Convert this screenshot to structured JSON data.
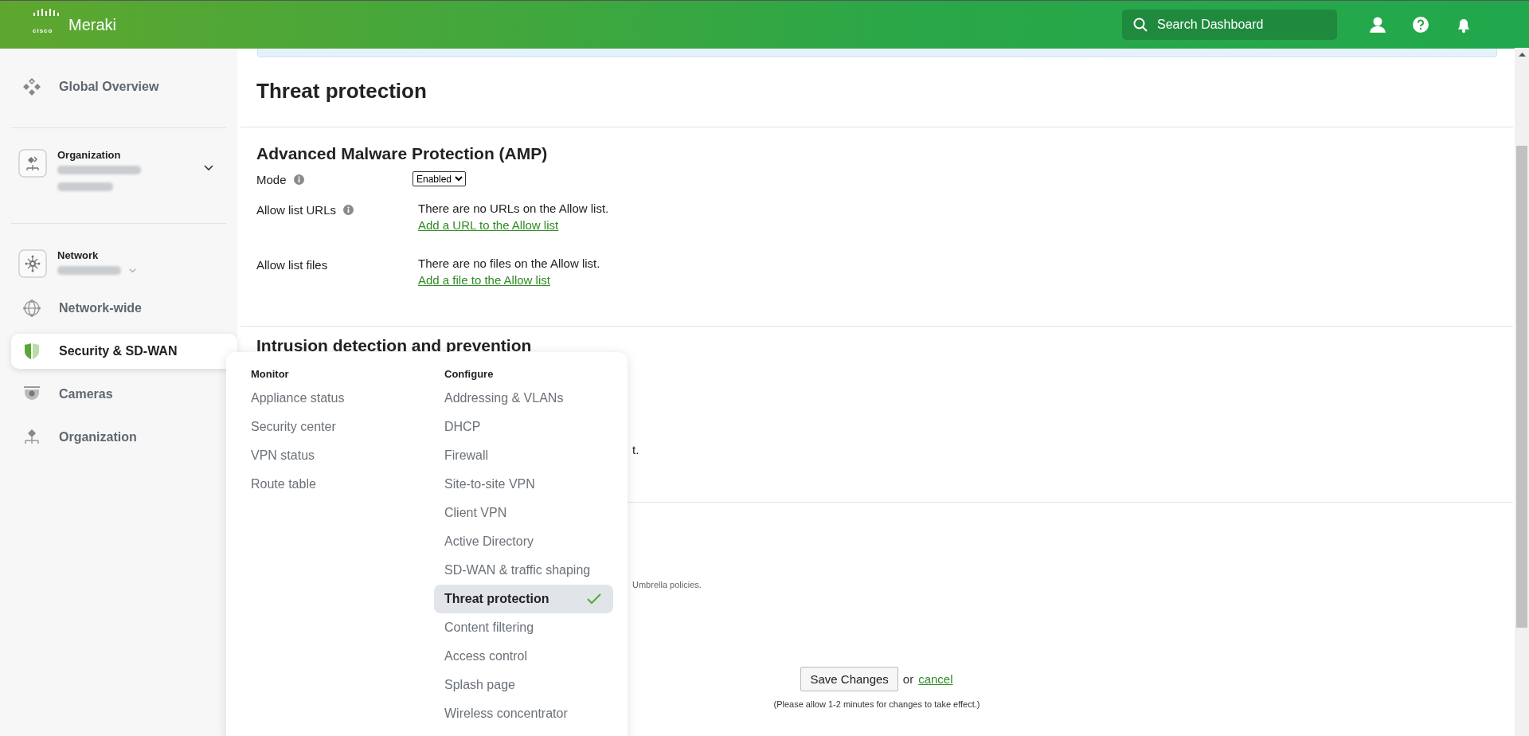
{
  "header": {
    "logo_mark": "cisco",
    "logo_text": "Meraki",
    "search": {
      "placeholder": "Search Dashboard"
    }
  },
  "sidebar": {
    "sections": [
      [
        {
          "kind": "link",
          "label": "Global Overview",
          "selected": false
        }
      ],
      [
        {
          "kind": "picker",
          "label": "Organization",
          "selected": false
        }
      ],
      [
        {
          "kind": "picker",
          "label": "Network",
          "selected": false
        },
        {
          "kind": "link",
          "label": "Network-wide",
          "selected": false
        },
        {
          "kind": "link",
          "label": "Security & SD-WAN",
          "selected": true
        },
        {
          "kind": "link",
          "label": "Cameras",
          "selected": false
        },
        {
          "kind": "link",
          "label": "Organization",
          "selected": false
        }
      ]
    ]
  },
  "page_title": "Threat protection",
  "amp": {
    "heading": "Advanced Malware Protection (AMP)",
    "fields": [
      {
        "kind": "select",
        "label": "Mode",
        "info": true,
        "value": "Enabled"
      },
      {
        "kind": "list",
        "label": "Allow list URLs",
        "info": true,
        "text": "There are no URLs on the Allow list.",
        "link": "Add a URL to the Allow list"
      },
      {
        "kind": "list",
        "label": "Allow list files",
        "info": false,
        "text": "There are no files on the Allow list.",
        "link": "Add a file to the Allow list"
      }
    ]
  },
  "ids": {
    "heading": "Intrusion detection and prevention",
    "fragment": "t."
  },
  "umbrella": {
    "fragment": "Umbrella policies."
  },
  "footer": {
    "save": "Save Changes",
    "or": "or",
    "cancel": "cancel",
    "note": "(Please allow 1-2 minutes for changes to take effect.)"
  },
  "flyout": {
    "columns": [
      {
        "heading": "Monitor",
        "items": [
          {
            "label": "Appliance status",
            "selected": false
          },
          {
            "label": "Security center",
            "selected": false
          },
          {
            "label": "VPN status",
            "selected": false
          },
          {
            "label": "Route table",
            "selected": false
          }
        ]
      },
      {
        "heading": "Configure",
        "items": [
          {
            "label": "Addressing & VLANs",
            "selected": false
          },
          {
            "label": "DHCP",
            "selected": false
          },
          {
            "label": "Firewall",
            "selected": false
          },
          {
            "label": "Site-to-site VPN",
            "selected": false
          },
          {
            "label": "Client VPN",
            "selected": false
          },
          {
            "label": "Active Directory",
            "selected": false
          },
          {
            "label": "SD-WAN & traffic shaping",
            "selected": false
          },
          {
            "label": "Threat protection",
            "selected": true
          },
          {
            "label": "Content filtering",
            "selected": false
          },
          {
            "label": "Access control",
            "selected": false
          },
          {
            "label": "Splash page",
            "selected": false
          },
          {
            "label": "Wireless concentrator",
            "selected": false
          }
        ]
      }
    ]
  }
}
